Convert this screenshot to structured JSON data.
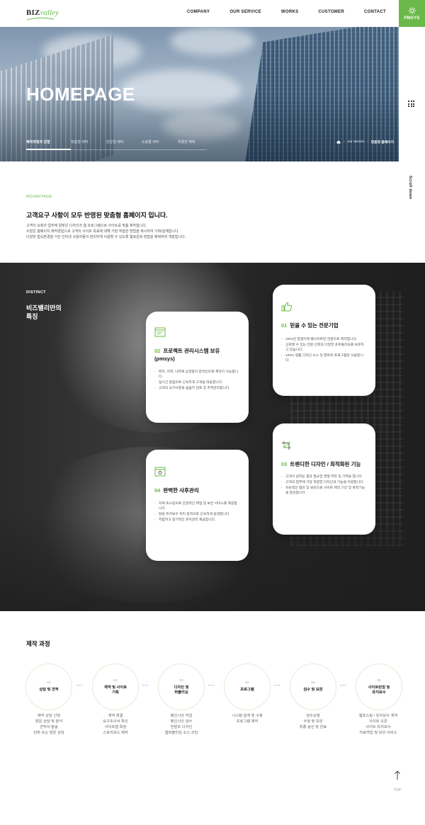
{
  "header": {
    "logo_biz": "BIZ",
    "logo_valley": "valley",
    "nav": [
      "COMPANY",
      "OUR SERVICE",
      "WORKS",
      "CUSTOMER",
      "CONTACT"
    ],
    "pmsys_label": "PMSYS"
  },
  "rail": {
    "scroll_label": "Scroll down"
  },
  "hero": {
    "title": "HOMEPAGE",
    "tabs": [
      "제작과정과 강점",
      "맞춤형 제작",
      "반응형 제작",
      "쇼핑몰 제작",
      "특별한 혜택"
    ],
    "active_tab": 0,
    "breadcrumb": [
      "our service",
      "맞춤형 홈페이지"
    ]
  },
  "advantage": {
    "eyebrow": "ADVANTAGE",
    "title": "고객요구 사항이 모두 반영된 맞춤형 홈페이지 입니다.",
    "desc": [
      "고객의 요청과 업무에 알맞은 디자인과 웹 프로그램으로 사이트를 맞춤 제작합니다.",
      "수많은 홈페이지 제작경험으로 고객의 사이트 목표에 대해 가장 적합한 방법을 제시하여 기획/설계합니다.",
      "다양한 접속환경을 가진 인터넷 사용자들이 편리하게 이용할 수 있도록 웹표준화 방법을 채택하여 개발합니다."
    ]
  },
  "distinct": {
    "eyebrow": "DISTINCT",
    "title": "비즈밸리만의\n특징",
    "cards": [
      {
        "num": "01",
        "title": "믿을 수 있는 전문기업",
        "icon": "thumbs-up-icon",
        "items": [
          "2001년 창업이래 웹사이트만 전문으로 제작합니다.",
          "신뢰할 수 있는 전문 인력과 다양한 포트폴리오를 보유하고 있습니다.",
          "100% 정품 디자인 소스 및 폰트와 프로그램만 사용합니다."
        ]
      },
      {
        "num": "02",
        "title": "프로젝트 관리시스템 보유 (pmsys)",
        "icon": "browser-window-icon",
        "items": [
          "위치, 지역, 나라에 상관없이 온라인으로 제작이 가능합니다.",
          "실시간 알림으로 신속하게 고객을 대응합니다.",
          "고객의 요구사항을 꼼꼼히 검토 및 추적관리합니다."
        ]
      },
      {
        "num": "03",
        "title": "트렌디한 디자인 / 최적화된 기능",
        "icon": "crop-icon",
        "items": [
          "고객이 원하는 결과 필요한 경쟁 파악 및 기획을 합니다.",
          "고객의 업무에 가장 적합한 디자인과 기능을 지원합니다.",
          "지속적인 협의 및 보완으로 사이트 제작 기간 및 목적기능을 달성합니다."
        ]
      },
      {
        "num": "04",
        "title": "완벽한 사후관리",
        "icon": "window-settings-icon",
        "items": [
          "자체 호스팅으로 안정적인 백업 및 보안 서비스를 제공합니다.",
          "담당 유지보수 처리 원칙으로 신속하게 응대합니다.",
          "저렴하고 정기적인 유지관리 제공합니다."
        ]
      }
    ]
  },
  "process": {
    "title": "제작 과정",
    "steps": [
      {
        "num": "01",
        "label": "상담 및 견적",
        "desc": "제작 상담 신청\n방문 상담 및 분석\n견적서 발송\n전화 또는 방문 상담"
      },
      {
        "num": "02",
        "label": "계약 및 사이트\n기획",
        "desc": "계약 체결\n요구조사서 확인\n사이트맵 확정\n스토리보드 제작"
      },
      {
        "num": "03",
        "label": "디자인 및\n퍼블리싱",
        "desc": "메인시안 작업\n메인시안 검수\n컨텐츠 디자인\n웹퍼블리싱 소스 코딩"
      },
      {
        "num": "04",
        "label": "프로그램",
        "desc": "시스템 설계 및 구축\n프로그램 제작"
      },
      {
        "num": "05",
        "label": "검수 및 보완",
        "desc": "검수요청\n수정 및 보완\n최종 승인 및 완료"
      },
      {
        "num": "06",
        "label": "사이트런칭 및\n유지보수",
        "desc": "웹호스팅 / 유지보수 계약\n사이트 오픈\n사이트 유지보수\n자료백업 및 보안 서비스"
      }
    ]
  },
  "top_button": {
    "label": "TOP"
  },
  "colors": {
    "accent": "#6bb94a",
    "dark": "#2a2a2a"
  }
}
